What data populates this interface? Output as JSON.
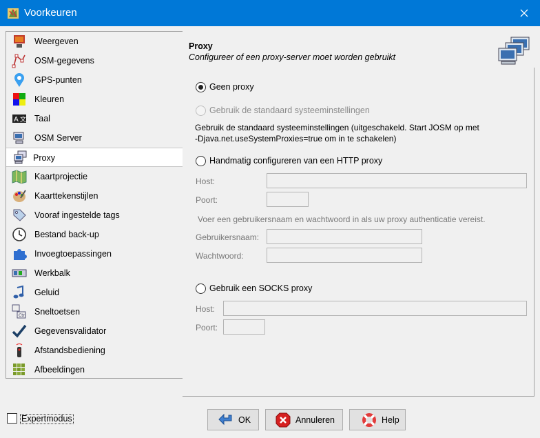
{
  "window": {
    "title": "Voorkeuren"
  },
  "sidebar": {
    "items": [
      {
        "label": "Weergeven",
        "icon": "display-icon"
      },
      {
        "label": "OSM-gegevens",
        "icon": "osm-data-icon"
      },
      {
        "label": "GPS-punten",
        "icon": "gps-pin-icon"
      },
      {
        "label": "Kleuren",
        "icon": "colors-icon"
      },
      {
        "label": "Taal",
        "icon": "language-icon"
      },
      {
        "label": "OSM Server",
        "icon": "server-icon"
      },
      {
        "label": "Proxy",
        "icon": "proxy-icon",
        "selected": true
      },
      {
        "label": "Kaartprojectie",
        "icon": "map-projection-icon"
      },
      {
        "label": "Kaarttekenstijlen",
        "icon": "palette-icon"
      },
      {
        "label": "Vooraf ingestelde tags",
        "icon": "tag-icon"
      },
      {
        "label": "Bestand back-up",
        "icon": "backup-clock-icon"
      },
      {
        "label": "Invoegtoepassingen",
        "icon": "plugin-icon"
      },
      {
        "label": "Werkbalk",
        "icon": "toolbar-icon"
      },
      {
        "label": "Geluid",
        "icon": "sound-icon"
      },
      {
        "label": "Sneltoetsen",
        "icon": "shortcuts-icon"
      },
      {
        "label": "Gegevensvalidator",
        "icon": "validator-check-icon"
      },
      {
        "label": "Afstandsbediening",
        "icon": "remote-control-icon"
      },
      {
        "label": "Afbeeldingen",
        "icon": "imagery-grid-icon"
      }
    ]
  },
  "panel": {
    "title": "Proxy",
    "subtitle": "Configureer of een proxy-server moet worden gebruikt",
    "no_proxy": "Geen proxy",
    "system_settings": "Gebruik de standaard systeeminstellingen",
    "system_note_1": "Gebruik de standaard systeeminstellingen (uitgeschakeld. Start JOSM op met",
    "system_note_2": "-Djava.net.useSystemProxies=true om in te schakelen)",
    "http_manual": "Handmatig configureren van een HTTP proxy",
    "host_label": "Host:",
    "port_label": "Poort:",
    "auth_note": "Voer een gebruikersnaam en wachtwoord in als uw proxy authenticatie vereist.",
    "username_label": "Gebruikersnaam:",
    "password_label": "Wachtwoord:",
    "socks": "Gebruik een SOCKS proxy",
    "socks_host_label": "Host:",
    "socks_port_label": "Poort:",
    "http_host_value": "",
    "http_port_value": "",
    "username_value": "",
    "password_value": "",
    "socks_host_value": "",
    "socks_port_value": ""
  },
  "footer": {
    "expert_mode": "Expertmodus",
    "ok": "OK",
    "cancel": "Annuleren",
    "help": "Help"
  }
}
